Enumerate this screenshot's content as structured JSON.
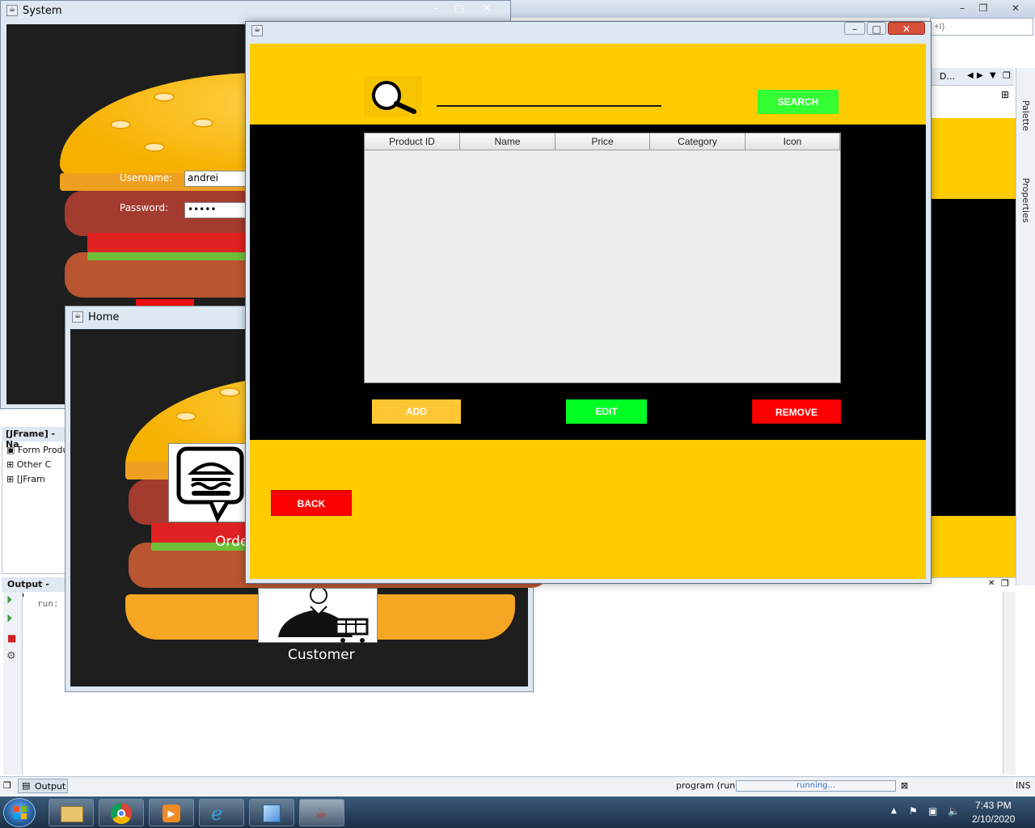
{
  "ide": {
    "search_placeholder": "+I)",
    "design_tab_label": "D...",
    "palette_label": "Palette",
    "properties_label": "Properties",
    "navigator_title": "[JFrame] - Na",
    "navigator_items": [
      "Form Produ",
      "Other C",
      "[JFram"
    ],
    "output_title": "Output - pro",
    "output_text": "run:",
    "output_tab_label": "Output",
    "status_text": "program (run)",
    "progress_text": "running...",
    "ins_text": "INS"
  },
  "system_window": {
    "title": "System",
    "username_label": "Username:",
    "username_value": "andrei",
    "password_label": "Password:",
    "password_value": "•••••"
  },
  "home_window": {
    "title": "Home",
    "order_label": "Orde",
    "customer_label": "Customer"
  },
  "product_window": {
    "search_button": "SEARCH",
    "search_value": "",
    "table_columns": [
      "Product ID",
      "Name",
      "Price",
      "Category",
      "Icon"
    ],
    "add_button": "ADD",
    "edit_button": "EDIT",
    "remove_button": "REMOVE",
    "back_button": "BACK"
  },
  "taskbar": {
    "time": "7:43 PM",
    "date": "2/10/2020"
  },
  "colors": {
    "yellow": "#ffcc00",
    "search_green": "#33ff33",
    "edit_green": "#00ff22",
    "red": "#ff0000",
    "add_yellow": "#ffc633"
  }
}
